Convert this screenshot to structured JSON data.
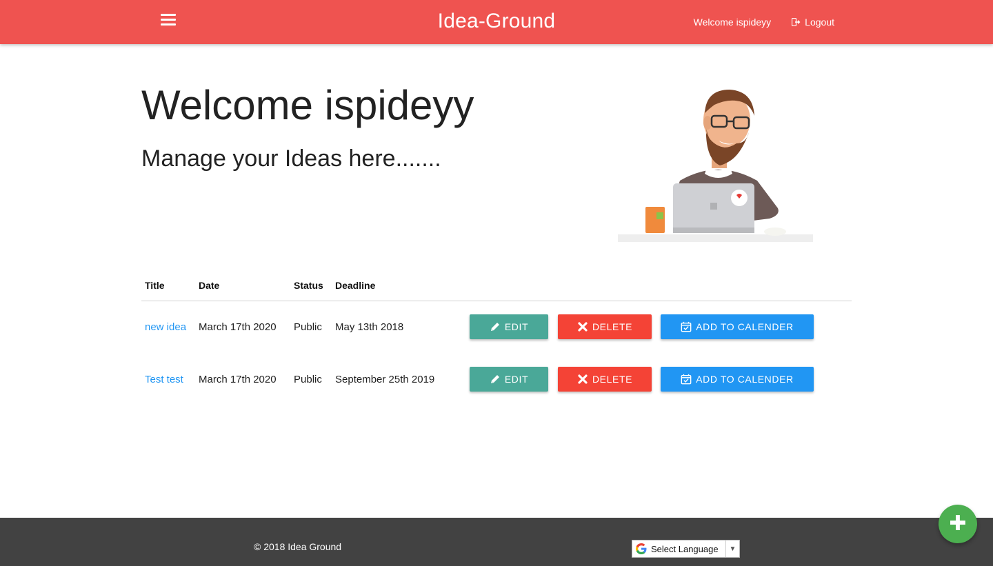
{
  "navbar": {
    "brand": "Idea-Ground",
    "welcome": "Welcome ispideyy",
    "logout": "Logout",
    "color": "#ef5350"
  },
  "hero": {
    "title": "Welcome ispideyy",
    "subtitle": "Manage your Ideas here......."
  },
  "table": {
    "headers": [
      "Title",
      "Date",
      "Status",
      "Deadline"
    ],
    "rows": [
      {
        "title": "new idea",
        "date": "March 17th 2020",
        "status": "Public",
        "deadline": "May 13th 2018"
      },
      {
        "title": "Test test",
        "date": "March 17th 2020",
        "status": "Public",
        "deadline": "September 25th 2019"
      }
    ],
    "edit_label": "EDIT",
    "delete_label": "DELETE",
    "calendar_label": "ADD TO CALENDER"
  },
  "footer": {
    "copyright": "© 2018 Idea Ground",
    "language_label": "Select Language"
  },
  "fab": {
    "icon": "plus-icon"
  },
  "colors": {
    "edit": "#4aa898",
    "delete": "#f44336",
    "calendar": "#2196f3",
    "fab": "#4caf50",
    "footer": "#424242"
  }
}
